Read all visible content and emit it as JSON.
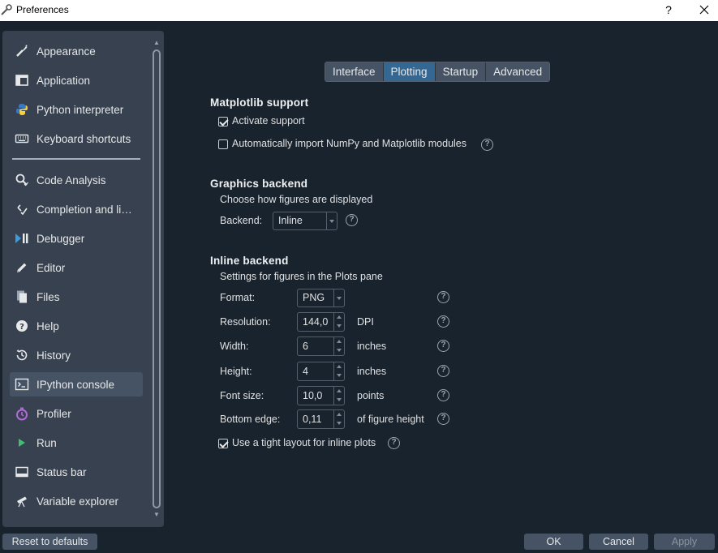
{
  "window": {
    "title": "Preferences",
    "help": "?"
  },
  "sidebar": {
    "items": [
      {
        "label": "Appearance",
        "icon": "paint-brush-icon"
      },
      {
        "label": "Application",
        "icon": "application-window-icon"
      },
      {
        "label": "Python interpreter",
        "icon": "python-logo-icon"
      },
      {
        "label": "Keyboard shortcuts",
        "icon": "keyboard-icon"
      },
      {
        "label": "Code Analysis",
        "icon": "magnifier-check-icon"
      },
      {
        "label": "Completion and li…",
        "icon": "completion-icon"
      },
      {
        "label": "Debugger",
        "icon": "debug-play-pause-icon"
      },
      {
        "label": "Editor",
        "icon": "pencil-icon"
      },
      {
        "label": "Files",
        "icon": "files-icon"
      },
      {
        "label": "Help",
        "icon": "help-circle-icon"
      },
      {
        "label": "History",
        "icon": "history-clock-icon"
      },
      {
        "label": "IPython console",
        "icon": "terminal-icon"
      },
      {
        "label": "Profiler",
        "icon": "stopwatch-icon"
      },
      {
        "label": "Run",
        "icon": "play-icon"
      },
      {
        "label": "Status bar",
        "icon": "status-bar-icon"
      },
      {
        "label": "Variable explorer",
        "icon": "telescope-icon"
      }
    ],
    "selected": "IPython console"
  },
  "tabs": [
    {
      "label": "Interface"
    },
    {
      "label": "Plotting"
    },
    {
      "label": "Startup"
    },
    {
      "label": "Advanced"
    }
  ],
  "active_tab": "Plotting",
  "matplotlib": {
    "heading": "Matplotlib support",
    "activate_label": "Activate support",
    "activate_checked": true,
    "auto_import_label": "Automatically import NumPy and Matplotlib modules",
    "auto_import_checked": false
  },
  "graphics": {
    "heading": "Graphics backend",
    "description": "Choose how figures are displayed",
    "backend_label": "Backend:",
    "backend_value": "Inline"
  },
  "inline": {
    "heading": "Inline backend",
    "description": "Settings for figures in the Plots pane",
    "format_label": "Format:",
    "format_value": "PNG",
    "resolution_label": "Resolution:",
    "resolution_value": "144,0",
    "resolution_unit": "DPI",
    "width_label": "Width:",
    "width_value": "6",
    "width_unit": "inches",
    "height_label": "Height:",
    "height_value": "4",
    "height_unit": "inches",
    "fontsize_label": "Font size:",
    "fontsize_value": "10,0",
    "fontsize_unit": "points",
    "bottom_label": "Bottom edge:",
    "bottom_value": "0,11",
    "bottom_unit": "of figure height",
    "tight_label": "Use a tight layout for inline plots",
    "tight_checked": true,
    "help_glyph": "?"
  },
  "buttons": {
    "reset": "Reset to defaults",
    "ok": "OK",
    "cancel": "Cancel",
    "apply": "Apply"
  },
  "colors": {
    "background": "#19232d",
    "panel": "#37414f",
    "selected": "#455364",
    "accent": "#346792"
  }
}
